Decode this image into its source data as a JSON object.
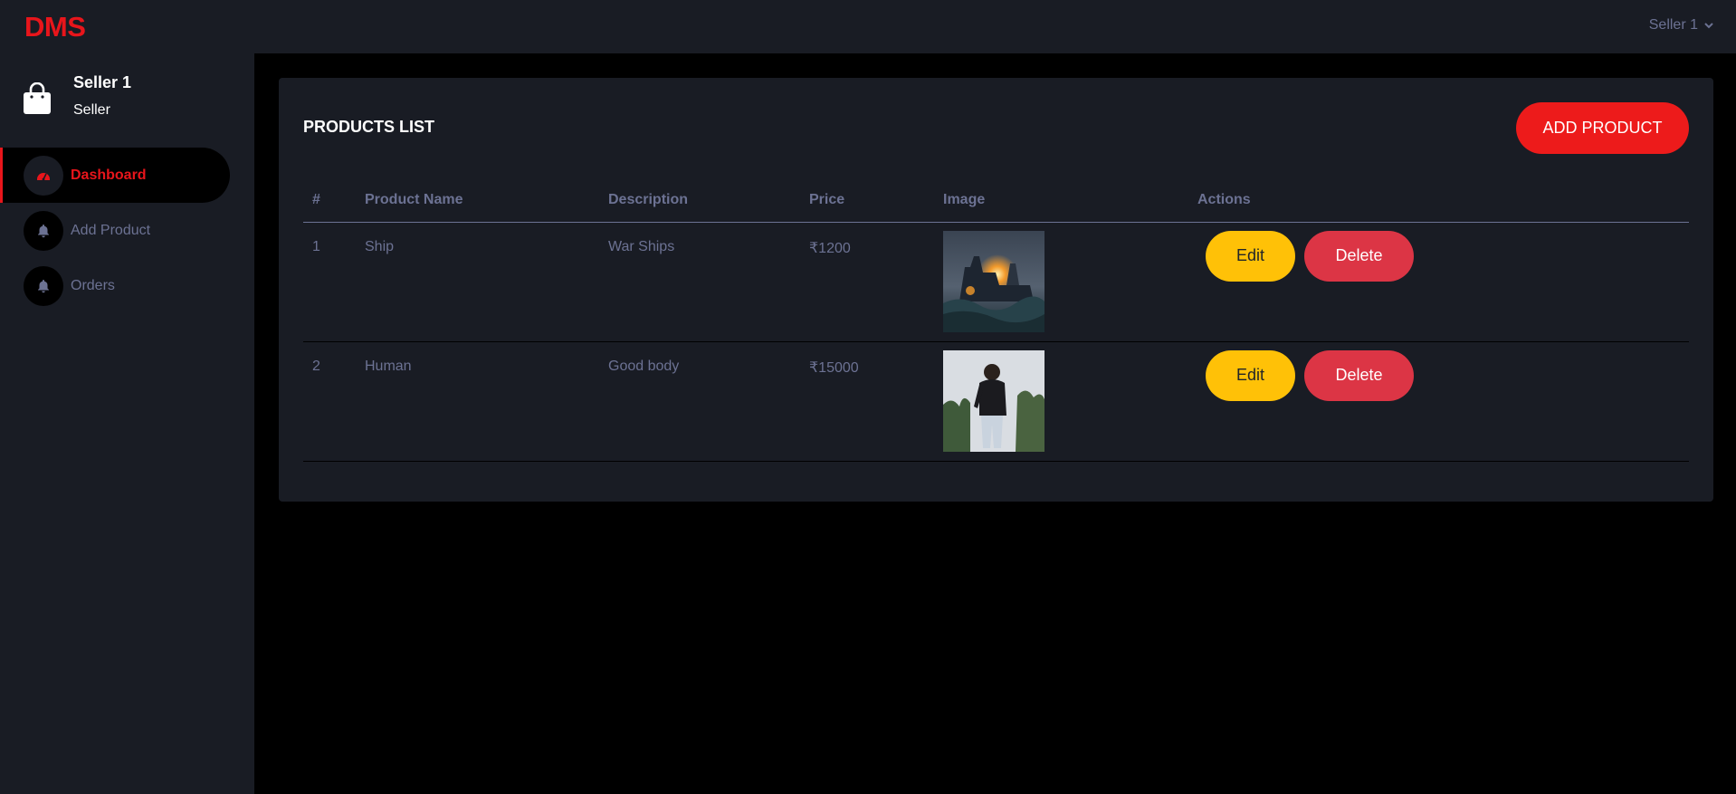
{
  "app": {
    "logo": "DMS",
    "user_menu_label": "Seller 1"
  },
  "profile": {
    "name": "Seller 1",
    "role": "Seller"
  },
  "sidebar": {
    "items": [
      {
        "label": "Dashboard",
        "icon": "speedometer-icon",
        "active": true
      },
      {
        "label": "Add Product",
        "icon": "bell-icon",
        "active": false
      },
      {
        "label": "Orders",
        "icon": "bell-icon",
        "active": false
      }
    ]
  },
  "products": {
    "title": "PRODUCTS LIST",
    "add_button": "ADD PRODUCT",
    "columns": [
      "#",
      "Product Name",
      "Description",
      "Price",
      "Image",
      "Actions"
    ],
    "rows": [
      {
        "index": "1",
        "name": "Ship",
        "description": "War Ships",
        "price": "₹1200",
        "image": "warship-image",
        "edit": "Edit",
        "delete": "Delete"
      },
      {
        "index": "2",
        "name": "Human",
        "description": "Good body",
        "price": "₹15000",
        "image": "person-image",
        "edit": "Edit",
        "delete": "Delete"
      }
    ]
  },
  "colors": {
    "accent": "#e8151b",
    "panel": "#191c24",
    "muted_text": "#6c7293",
    "edit": "#ffc107",
    "delete": "#dc3545"
  }
}
